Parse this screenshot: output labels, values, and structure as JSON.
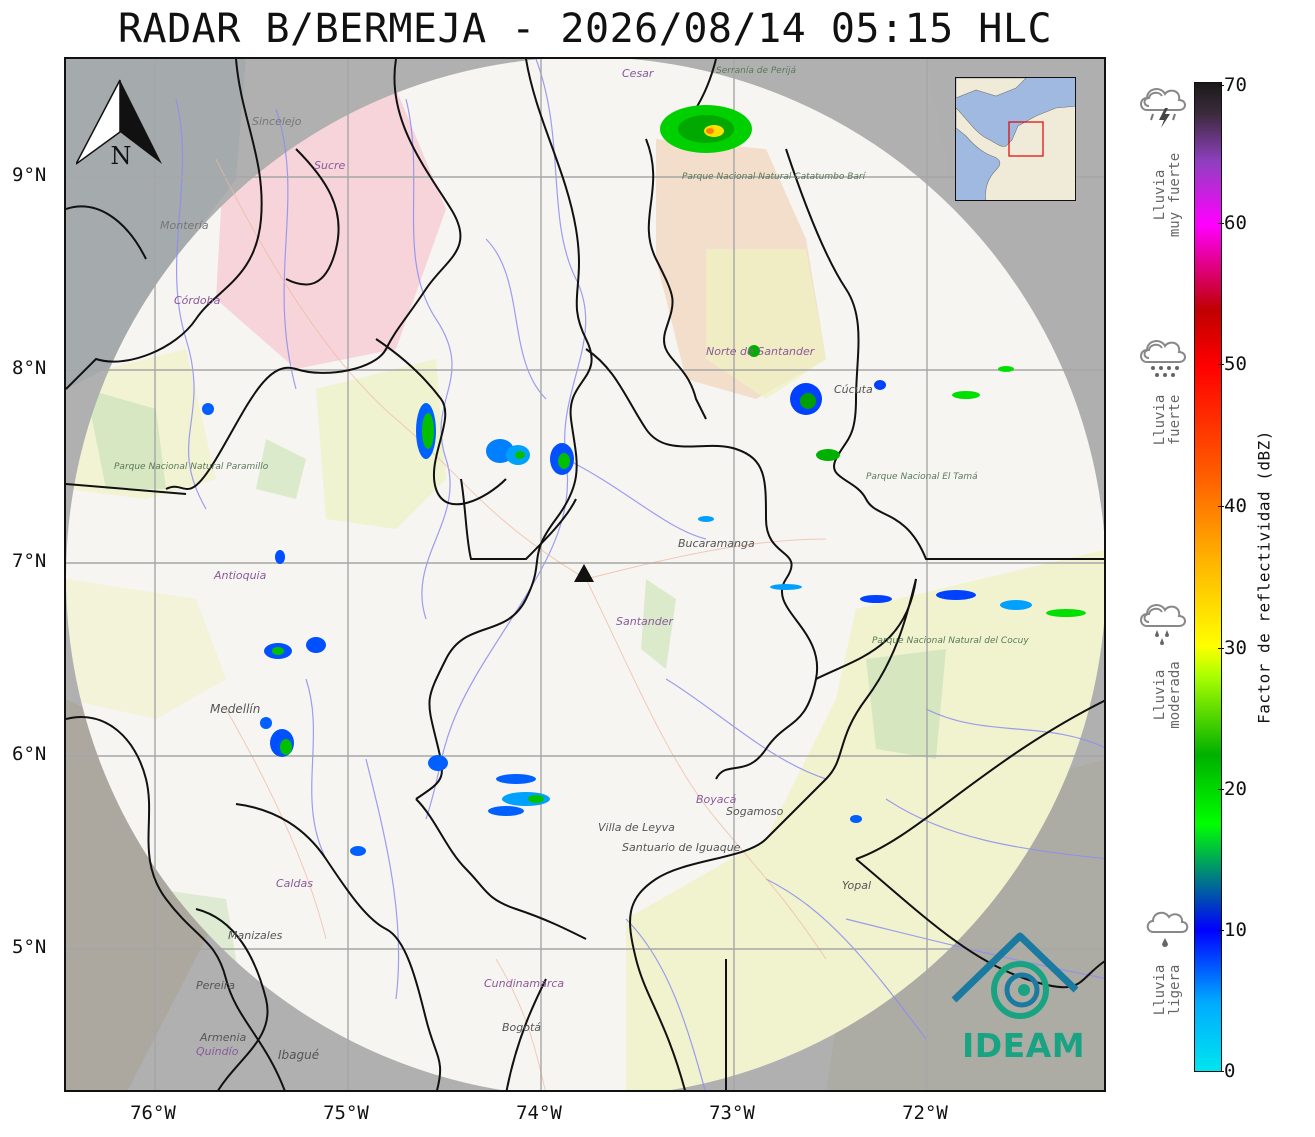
{
  "title": "RADAR B/BERMEJA - 2026/08/14 05:15 HLC",
  "map": {
    "lon_labels": [
      "76°W",
      "75°W",
      "74°W",
      "73°W",
      "72°W"
    ],
    "lat_labels": [
      "9°N",
      "8°N",
      "7°N",
      "6°N",
      "5°N"
    ],
    "north_arrow_label": "N",
    "radar_site_icon": "triangle-marker-icon",
    "place_labels": [
      "Sincelejo",
      "Sucre",
      "Montería",
      "Córdoba",
      "Parque Nacional Natural Paramillo",
      "Antioquia",
      "Medellín",
      "Caldas",
      "Manizales",
      "Pereira",
      "Armenia",
      "Quindío",
      "Ibagué",
      "Bogotá",
      "Cundinamarca",
      "Cesar",
      "Serranía de Perijá",
      "Parque Nacional Natural Catatumbo Barí",
      "Norte de Santander",
      "Cúcuta",
      "Parque Nacional El Tamá",
      "Bucaramanga",
      "Santander",
      "Boyacá",
      "Sogamoso",
      "Villa de Leyva",
      "Santuario de Iguaque",
      "Parque Nacional Natural del Cocuy",
      "Yopal"
    ]
  },
  "colorbar": {
    "title": "Factor de reflectividad (dBZ)",
    "ticks": [
      "0",
      "10",
      "20",
      "30",
      "40",
      "50",
      "60",
      "70"
    ],
    "colors": [
      "#00e5ee",
      "#0000ff",
      "#00ff00",
      "#00b000",
      "#ffff00",
      "#ff6000",
      "#ff0000",
      "#ff00ff",
      "#1a1a1a"
    ]
  },
  "rain_categories": [
    {
      "label_line1": "Lluvia",
      "label_line2": "muy fuerte",
      "icon": "thunderstorm-cloud-icon"
    },
    {
      "label_line1": "Lluvia",
      "label_line2": "fuerte",
      "icon": "heavy-rain-cloud-icon"
    },
    {
      "label_line1": "Lluvia",
      "label_line2": "moderada",
      "icon": "moderate-rain-cloud-icon"
    },
    {
      "label_line1": "Lluvia",
      "label_line2": "ligera",
      "icon": "light-rain-cloud-icon"
    }
  ],
  "logo": {
    "text": "IDEAM",
    "color": "#1aa382"
  }
}
